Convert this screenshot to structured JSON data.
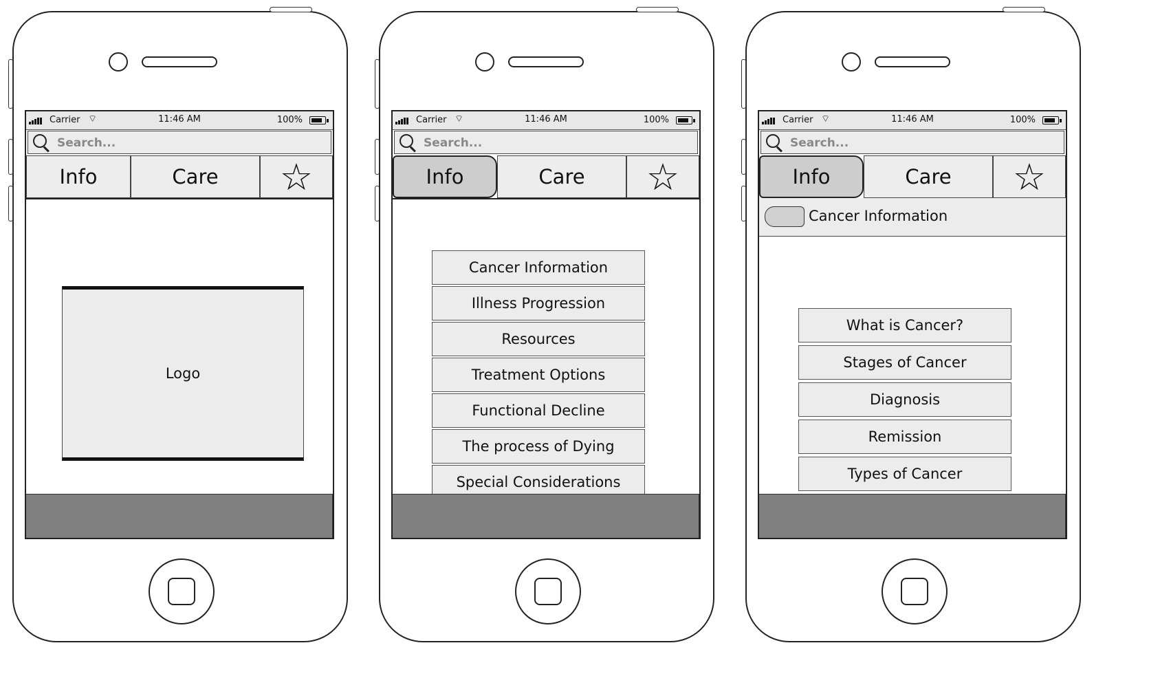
{
  "status": {
    "carrier": "Carrier",
    "time": "11:46 AM",
    "battery": "100%"
  },
  "search": {
    "placeholder": "Search..."
  },
  "tabs": {
    "info": "Info",
    "care": "Care",
    "favorites": "☆"
  },
  "screen1": {
    "logo": "Logo"
  },
  "screen2": {
    "menu": [
      "Cancer Information",
      "Illness Progression",
      "Resources",
      "Treatment Options",
      "Functional Decline",
      "The process of Dying",
      "Special Considerations"
    ]
  },
  "screen3": {
    "header_title": "Cancer Information",
    "menu": [
      "What is Cancer?",
      "Stages of Cancer",
      "Diagnosis",
      "Remission",
      "Types of Cancer"
    ]
  }
}
